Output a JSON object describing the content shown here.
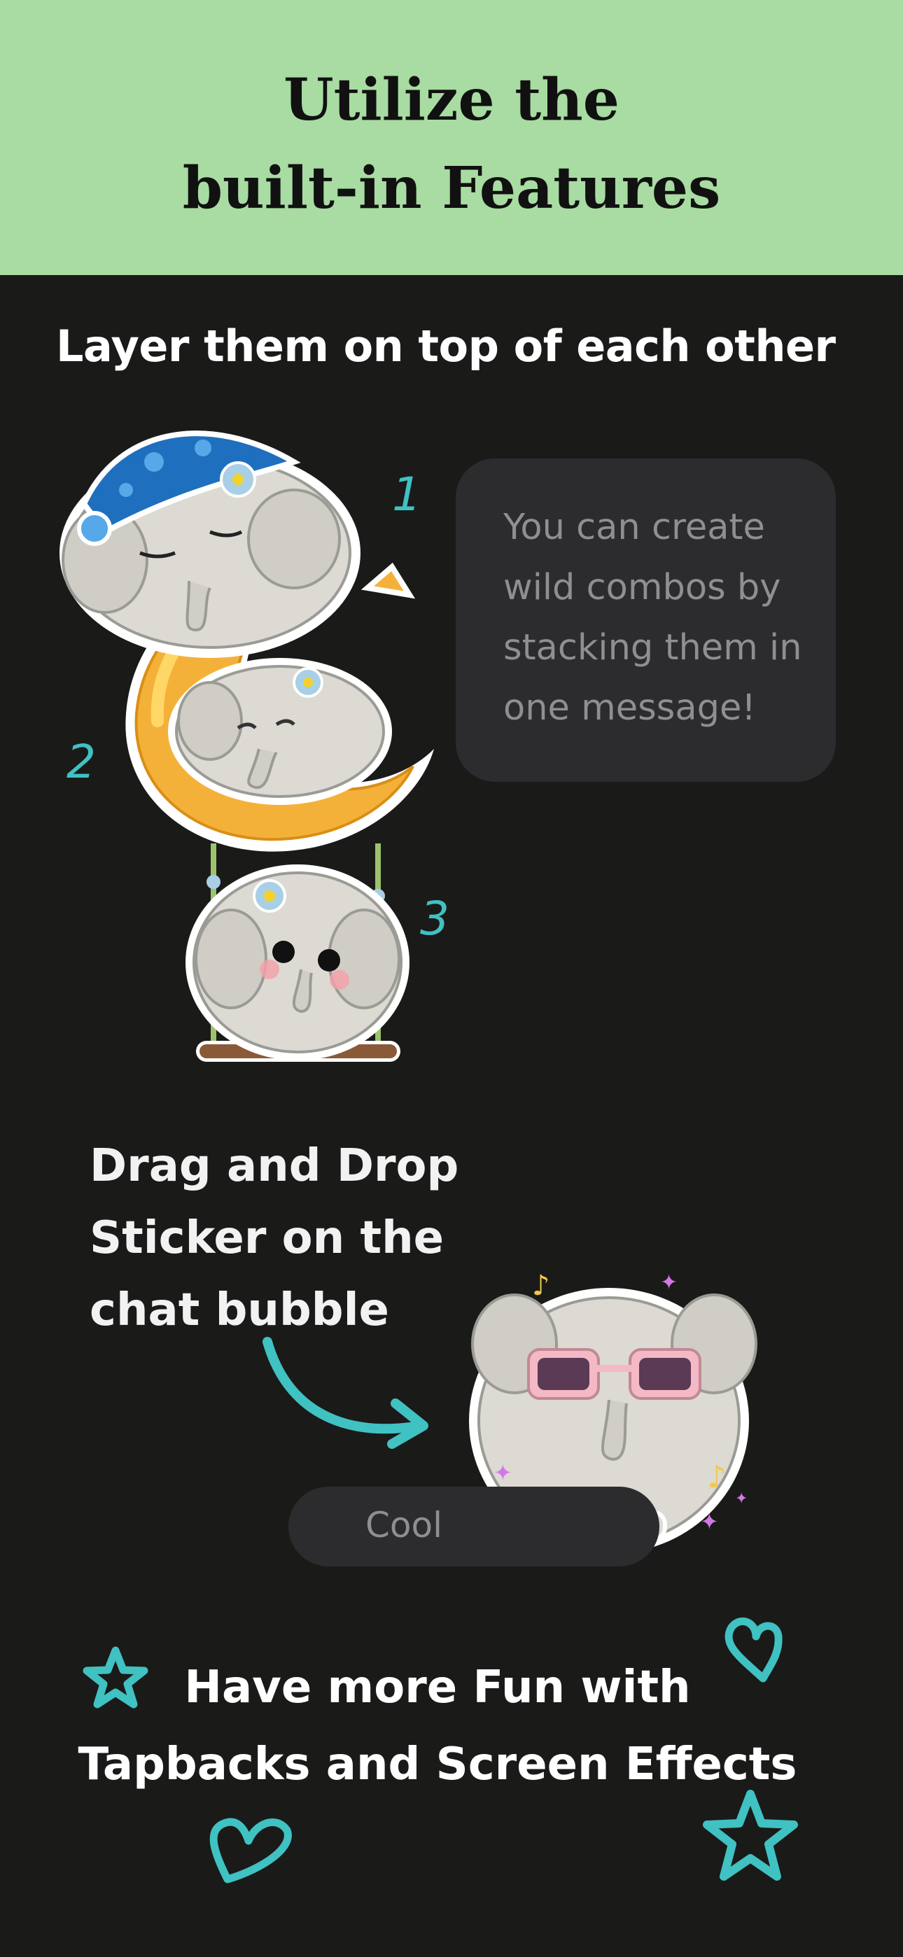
{
  "header": {
    "title_line1": "Utilize the",
    "title_line2": "built-in Features",
    "background": "#a8dca2"
  },
  "layer_section": {
    "title": "Layer them on top of each other",
    "bubble_lines": [
      "You can create",
      "wild combos by",
      "stacking them in",
      "one message!"
    ],
    "numbers": [
      "1",
      "2",
      "3"
    ]
  },
  "drag_section": {
    "lines": [
      "Drag and Drop",
      "Sticker on the",
      "chat bubble"
    ],
    "bubble_text": "Cool"
  },
  "fun_section": {
    "line1": "Have more Fun with",
    "line2": "Tapbacks and Screen Effects"
  },
  "colors": {
    "background": "#1a1a19",
    "accent": "#40c1c2",
    "bubble": "#2c2c2e"
  },
  "icons": [
    "star-icon",
    "heart-icon",
    "arrow-icon",
    "elephant-sleeping-sticker",
    "moon-elephant-sticker",
    "swing-elephant-sticker",
    "cool-elephant-sticker"
  ]
}
